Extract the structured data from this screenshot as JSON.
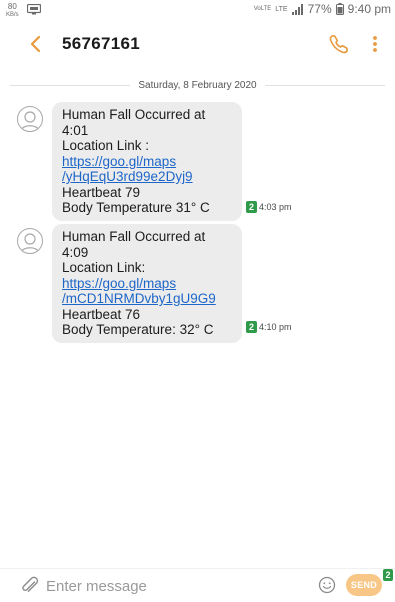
{
  "status_bar": {
    "net_speed_value": "80",
    "net_speed_unit": "KB/s",
    "net_type_1": "VoLTE",
    "net_type_2": "LTE",
    "battery": "77%",
    "time": "9:40 pm"
  },
  "header": {
    "title": "56767161"
  },
  "date_divider": "Saturday, 8 February 2020",
  "messages": [
    {
      "line1": "Human Fall Occurred at",
      "line2": "4:01",
      "line3": "Location Link :",
      "link_line1": "https://goo.gl/maps",
      "link_line2": "/yHqEqU3rd99e2Dyj9",
      "line6": "Heartbeat 79",
      "line7": "Body Temperature 31° C",
      "sim": "2",
      "time": "4:03 pm"
    },
    {
      "line1": "Human Fall Occurred at",
      "line2": "4:09",
      "line3": "Location Link:",
      "link_line1": "https://goo.gl/maps",
      "link_line2": "/mCD1NRMDvby1gU9G9",
      "line6": "Heartbeat 76",
      "line7": "Body Temperature: 32° C",
      "sim": "2",
      "time": "4:10 pm"
    }
  ],
  "input_bar": {
    "placeholder": "Enter message",
    "value": "",
    "send_label": "SEND",
    "send_sim": "2"
  },
  "icons": {
    "back": "chevron-left-icon",
    "call": "phone-icon",
    "menu": "more-vertical-icon",
    "avatar": "contact-avatar-icon",
    "attach": "paperclip-icon",
    "emoji": "smiley-icon"
  },
  "colors": {
    "accent": "#e89a3c",
    "link": "#1e66c8",
    "bubble": "#ececec",
    "sim_badge": "#2e9a4a",
    "send_button": "#f8c787"
  }
}
